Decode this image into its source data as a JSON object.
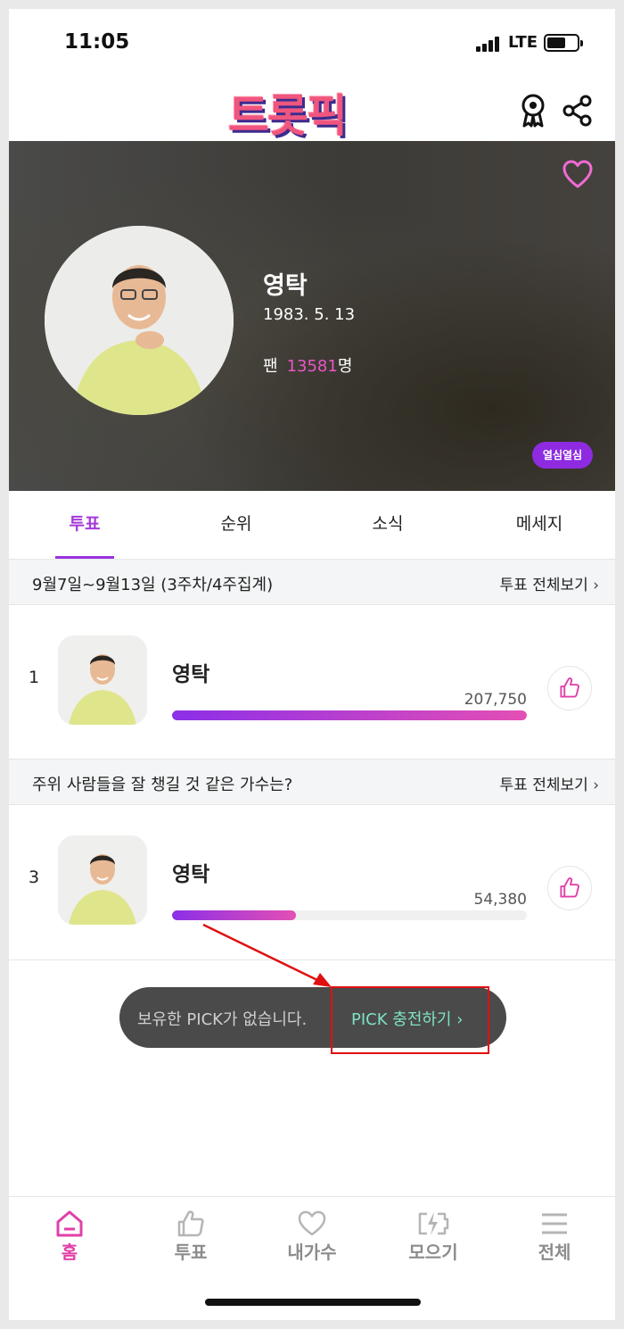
{
  "status_bar": {
    "time": "11:05",
    "network": "LTE"
  },
  "header": {
    "logo_text": "트롯픽",
    "icons": [
      "award-icon",
      "share-icon"
    ]
  },
  "profile": {
    "name": "영탁",
    "birth": "1983. 5. 13",
    "fan_label": "팬",
    "fan_count": "13581",
    "fan_unit": "명",
    "badge": "열심열심"
  },
  "tabs": [
    {
      "label": "투표",
      "active": true
    },
    {
      "label": "순위",
      "active": false
    },
    {
      "label": "소식",
      "active": false
    },
    {
      "label": "메세지",
      "active": false
    }
  ],
  "votes": [
    {
      "section_title": "9월7일~9월13일 (3주차/4주집계)",
      "more_label": "투표 전체보기",
      "rank": "1",
      "name": "영탁",
      "count": "207,750",
      "progress": 1.0
    },
    {
      "section_title": "주위 사람들을 잘 챙길 것 같은 가수는?",
      "more_label": "투표 전체보기",
      "rank": "3",
      "name": "영탁",
      "count": "54,380",
      "progress": 0.35
    }
  ],
  "toast": {
    "message": "보유한 PICK가 없습니다.",
    "cta": "PICK 충전하기"
  },
  "bottom_nav": [
    {
      "label": "홈",
      "icon": "home-icon",
      "active": true
    },
    {
      "label": "투표",
      "icon": "thumbs-up-icon",
      "active": false
    },
    {
      "label": "내가수",
      "icon": "heart-icon",
      "active": false
    },
    {
      "label": "모으기",
      "icon": "battery-charge-icon",
      "active": false
    },
    {
      "label": "전체",
      "icon": "menu-icon",
      "active": false
    }
  ],
  "colors": {
    "accent": "#9a32e0",
    "pink": "#e040a8",
    "toast_cta": "#7fe2c5",
    "annotation": "#e01010"
  }
}
